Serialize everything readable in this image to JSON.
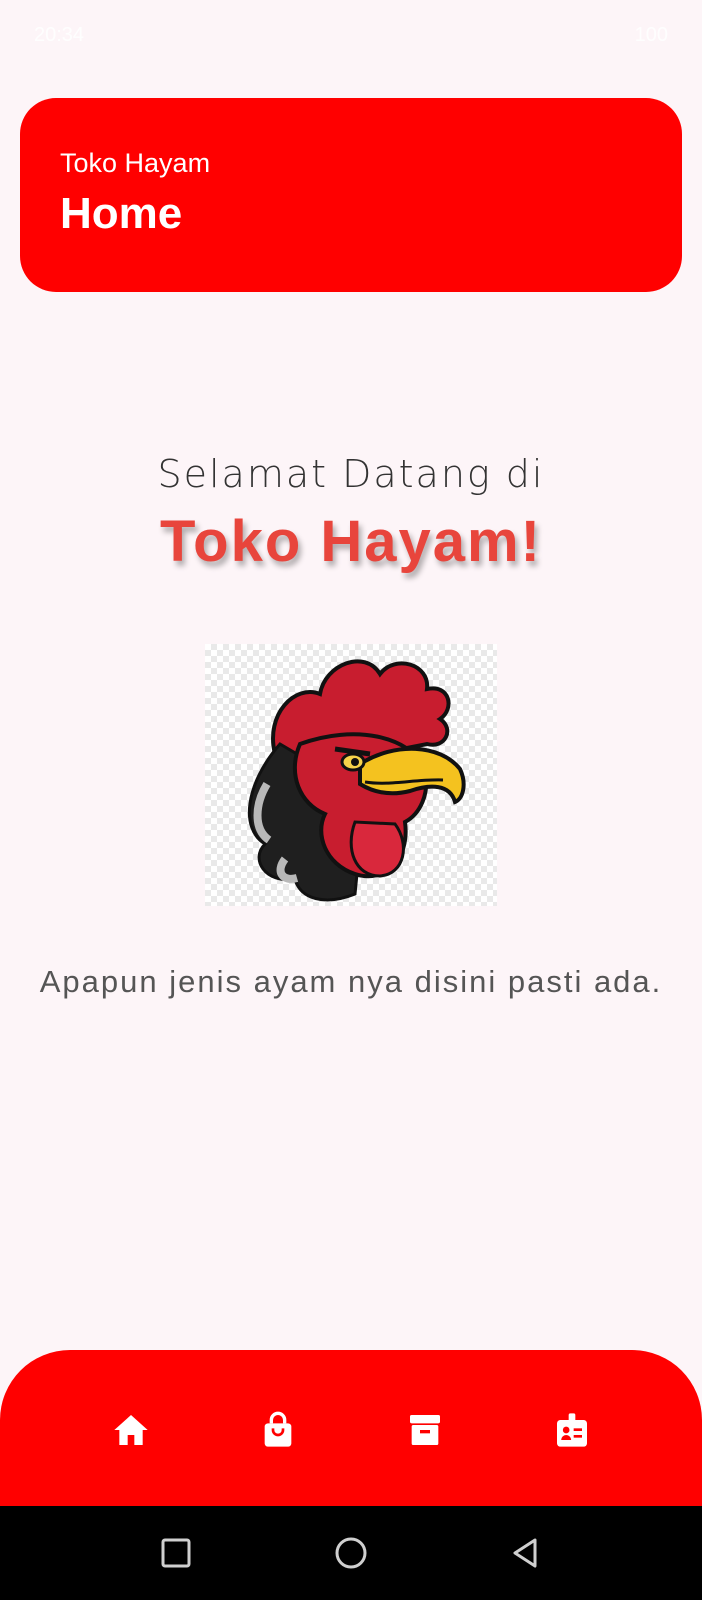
{
  "status_bar": {
    "time": "20:34",
    "battery": "100"
  },
  "header": {
    "subtitle": "Toko Hayam",
    "title": "Home"
  },
  "main": {
    "welcome": "Selamat Datang di",
    "brand": "Toko Hayam!",
    "tagline": "Apapun jenis ayam nya disini pasti ada."
  },
  "bottom_nav": {
    "items": [
      {
        "icon": "home-icon"
      },
      {
        "icon": "shopping-bag-icon"
      },
      {
        "icon": "archive-icon"
      },
      {
        "icon": "contact-card-icon"
      }
    ]
  },
  "system_nav": {
    "items": [
      {
        "icon": "recents-square-icon"
      },
      {
        "icon": "home-circle-icon"
      },
      {
        "icon": "back-triangle-icon"
      }
    ]
  },
  "colors": {
    "primary": "#ff0000",
    "brand_text": "#e8453c",
    "background": "#fdf5f8"
  }
}
